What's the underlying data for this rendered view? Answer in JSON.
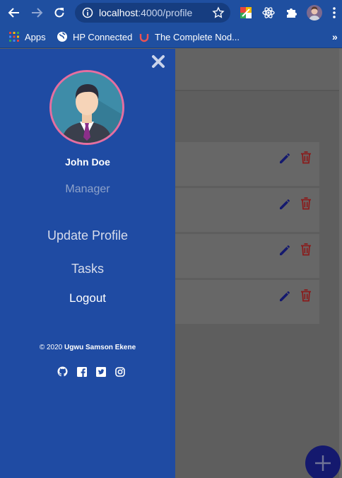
{
  "browser": {
    "url_host": "localhost",
    "url_rest": ":4000/profile",
    "bookmarks": [
      {
        "label": "Apps",
        "icon": "apps-grid-icon"
      },
      {
        "label": "HP Connected",
        "icon": "globe-icon"
      },
      {
        "label": "The Complete Nod...",
        "icon": "udemy-icon"
      }
    ],
    "bookmarks_more": "»"
  },
  "sidenav": {
    "user_name": "John Doe",
    "user_role": "Manager",
    "links": {
      "update_profile": "Update Profile",
      "tasks": "Tasks",
      "logout": "Logout"
    },
    "copyright_prefix": "© 2020 ",
    "copyright_author": "Ugwu Samson Ekene",
    "socials": [
      "github-icon",
      "facebook-icon",
      "twitter-icon",
      "instagram-icon"
    ]
  },
  "page": {
    "task_count": 4
  },
  "colors": {
    "sidenav_bg": "#1f4ba3",
    "avatar_border": "#e66ea0",
    "edit_icon": "#14196e",
    "delete_icon": "#8b1a1a",
    "fab": "#14196e"
  }
}
